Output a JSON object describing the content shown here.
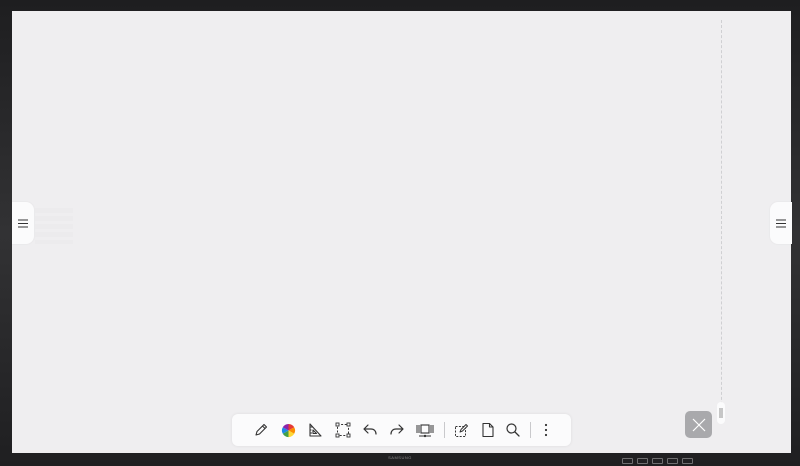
{
  "device": {
    "brand": "SAMSUNG"
  },
  "canvas": {
    "background": "#efeef0"
  },
  "side_menus": {
    "left": {
      "icon": "hamburger-icon"
    },
    "right": {
      "icon": "hamburger-icon"
    }
  },
  "toolbar": {
    "tools": [
      {
        "name": "pen-tool",
        "icon": "pencil-icon"
      },
      {
        "name": "color-picker",
        "icon": "color-wheel-icon"
      },
      {
        "name": "ruler-tool",
        "icon": "ruler-triangle-icon"
      },
      {
        "name": "selection-tool",
        "icon": "selection-box-icon"
      },
      {
        "name": "undo",
        "icon": "undo-icon"
      },
      {
        "name": "redo",
        "icon": "redo-icon"
      },
      {
        "name": "page-navigator",
        "icon": "pages-icon"
      },
      {
        "name": "edit-note",
        "icon": "edit-note-icon"
      },
      {
        "name": "new-page",
        "icon": "page-icon"
      },
      {
        "name": "zoom",
        "icon": "magnifier-icon"
      },
      {
        "name": "more-options",
        "icon": "more-vertical-icon"
      }
    ]
  },
  "close_button": {
    "icon": "close-icon",
    "color": "#a9a9ac"
  }
}
